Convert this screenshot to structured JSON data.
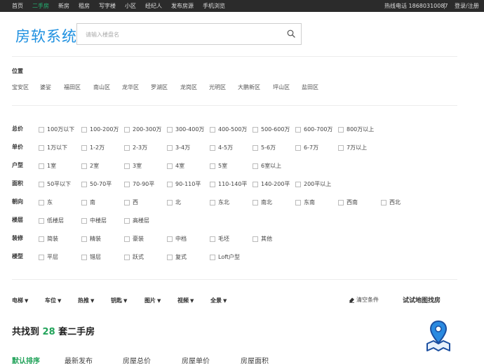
{
  "topnav": {
    "items": [
      "首页",
      "二手房",
      "新房",
      "租房",
      "写字楼",
      "小区",
      "经纪人",
      "发布房源",
      "手机浏览"
    ],
    "active_index": 1,
    "hotline": "热线电话 18680310087",
    "login": "登录/注册"
  },
  "header": {
    "logo": "房软系统",
    "search_placeholder": "请输入楼盘名"
  },
  "location": {
    "title": "位置",
    "districts": [
      "宝安区",
      "婆娑",
      "福田区",
      "南山区",
      "龙华区",
      "罗湖区",
      "龙岗区",
      "光明区",
      "大鹏新区",
      "坪山区",
      "盐田区"
    ]
  },
  "filters": [
    {
      "label": "总价",
      "options": [
        "100万以下",
        "100-200万",
        "200-300万",
        "300-400万",
        "400-500万",
        "500-600万",
        "600-700万",
        "800万以上"
      ]
    },
    {
      "label": "单价",
      "options": [
        "1万以下",
        "1-2万",
        "2-3万",
        "3-4万",
        "4-5万",
        "5-6万",
        "6-7万",
        "7万以上"
      ]
    },
    {
      "label": "户型",
      "options": [
        "1室",
        "2室",
        "3室",
        "4室",
        "5室",
        "6室以上"
      ]
    },
    {
      "label": "面积",
      "options": [
        "50平以下",
        "50-70平",
        "70-90平",
        "90-110平",
        "110-140平",
        "140-200平",
        "200平以上"
      ]
    },
    {
      "label": "朝向",
      "options": [
        "东",
        "南",
        "西",
        "北",
        "东北",
        "南北",
        "东南",
        "西南",
        "西北"
      ]
    },
    {
      "label": "楼层",
      "options": [
        "低楼层",
        "中楼层",
        "高楼层"
      ]
    },
    {
      "label": "装修",
      "options": [
        "简装",
        "精装",
        "豪装",
        "中档",
        "毛坯",
        "其他"
      ]
    },
    {
      "label": "楼型",
      "options": [
        "平层",
        "错层",
        "跃式",
        "复式",
        "Loft户型"
      ]
    }
  ],
  "sortbar": {
    "items": [
      "电梯",
      "车位",
      "热推",
      "钥匙",
      "图片",
      "视频",
      "全景"
    ],
    "clear": "清空条件",
    "map_search": "试试地图找房"
  },
  "result": {
    "prefix": "共找到",
    "count": "28",
    "suffix": "套二手房"
  },
  "tabs": [
    "默认排序",
    "最新发布",
    "房屋总价",
    "房屋单价",
    "房屋面积"
  ],
  "colors": {
    "accent_green": "#22a35a",
    "logo_blue": "#1e90e0",
    "topbar_bg": "#2b2b2b"
  }
}
